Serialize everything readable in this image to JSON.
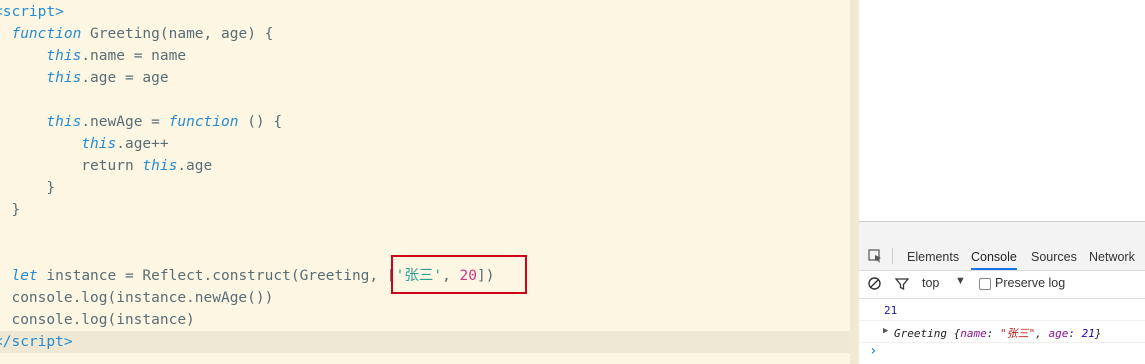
{
  "editor": {
    "lines": [
      {
        "parts": [
          {
            "t": "<",
            "c": "tag"
          },
          {
            "t": "script",
            "c": "tag"
          },
          {
            "t": ">",
            "c": "tag"
          }
        ]
      },
      {
        "parts": [
          {
            "t": "  "
          },
          {
            "t": "function",
            "c": "kw"
          },
          {
            "t": " "
          },
          {
            "t": "Greeting",
            "c": ""
          },
          {
            "t": "(name, age) {"
          }
        ]
      },
      {
        "parts": [
          {
            "t": "      "
          },
          {
            "t": "this",
            "c": "kw"
          },
          {
            "t": ".name = name"
          }
        ]
      },
      {
        "parts": [
          {
            "t": "      "
          },
          {
            "t": "this",
            "c": "kw"
          },
          {
            "t": ".age = age"
          }
        ]
      },
      {
        "parts": [
          {
            "t": ""
          }
        ]
      },
      {
        "parts": [
          {
            "t": "      "
          },
          {
            "t": "this",
            "c": "kw"
          },
          {
            "t": ".newAge = "
          },
          {
            "t": "function",
            "c": "kw"
          },
          {
            "t": " () {"
          }
        ]
      },
      {
        "parts": [
          {
            "t": "          "
          },
          {
            "t": "this",
            "c": "kw"
          },
          {
            "t": ".age++"
          }
        ]
      },
      {
        "parts": [
          {
            "t": "          return "
          },
          {
            "t": "this",
            "c": "kw"
          },
          {
            "t": ".age"
          }
        ]
      },
      {
        "parts": [
          {
            "t": "      }"
          }
        ]
      },
      {
        "parts": [
          {
            "t": "  }"
          }
        ]
      },
      {
        "parts": [
          {
            "t": ""
          }
        ]
      },
      {
        "parts": [
          {
            "t": ""
          }
        ]
      },
      {
        "parts": [
          {
            "t": "  "
          },
          {
            "t": "let",
            "c": "kw"
          },
          {
            "t": " instance = Reflect.construct(Greeting, ["
          },
          {
            "t": "'张三'",
            "c": "str"
          },
          {
            "t": ", "
          },
          {
            "t": "20",
            "c": "num"
          },
          {
            "t": "])"
          }
        ]
      },
      {
        "parts": [
          {
            "t": "  console.log(instance.newAge())"
          }
        ]
      },
      {
        "parts": [
          {
            "t": "  console.log(instance)"
          }
        ]
      },
      {
        "parts": [
          {
            "t": "</",
            "c": "tag"
          },
          {
            "t": "script",
            "c": "tag"
          },
          {
            "t": ">",
            "c": "tag"
          }
        ],
        "highlight": true
      }
    ]
  },
  "devtools": {
    "tabs": [
      "Elements",
      "Console",
      "Sources",
      "Network"
    ],
    "active_tab": "Console",
    "context": "top",
    "preserve_log_label": "Preserve log",
    "preserve_log_checked": false,
    "output": {
      "number": "21",
      "object_name": "Greeting",
      "object_key_name": "name",
      "object_val_name": "\"张三\"",
      "object_key_age": "age",
      "object_val_age": "21"
    },
    "prompt": "›"
  }
}
